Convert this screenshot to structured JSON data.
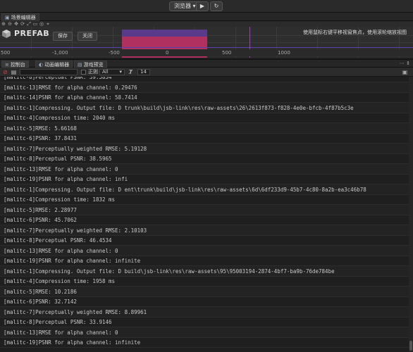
{
  "toolbar": {
    "preview_label": "浏览器 ▾",
    "play_glyph": "▶",
    "refresh_glyph": "↻"
  },
  "scene_panel": {
    "tab_label": "场景编辑器",
    "prefab_title": "PREFAB",
    "save_label": "保存",
    "close_label": "关闭",
    "hint_text": "使用鼠标右键平移视窗焦点，使用滚轮缩放视图",
    "ruler_labels": [
      "-1,000",
      "-500",
      "0",
      "500",
      "1000"
    ],
    "ruler_edge": "500"
  },
  "bottom_tabs": [
    {
      "label": "控制台"
    },
    {
      "label": "动画编辑器"
    },
    {
      "label": "游戏预览"
    }
  ],
  "console_toolbar": {
    "regex_label": "正则",
    "filter_value": "All",
    "font_size_value": "14"
  },
  "console_lines": [
    "[malitc-8]Perceptual PSNR: 39.5834",
    "[malitc-13]RMSE for alpha channel: 0.29476",
    "[malitc-14]PSNR for alpha channel: 58.7414",
    "[malitc-1]Compressing. Output file: D                        trunk\\build\\jsb-link\\res\\raw-assets\\26\\2613f873-f828-4e0e-bfcb-4f87b5c3e",
    "[malitc-4]Compression time: 2040 ms",
    "[malitc-5]RMSE: 5.66168",
    "[malitc-6]PSNR: 37.8431",
    "[malitc-7]Perceptually weighted RMSE: 5.19128",
    "[malitc-8]Perceptual PSNR: 38.5965",
    "[malitc-13]RMSE for alpha channel: 0",
    "[malitc-19]PSNR for alpha channel: infi",
    "[malitc-1]Compressing. Output file: D                      ent\\trunk\\build\\jsb-link\\res\\raw-assets\\6d\\6df233d9-45b7-4c80-8a2b-ea3c46b78",
    "[malitc-4]Compression time: 1832 ms",
    "[malitc-5]RMSE: 2.28977",
    "[malitc-6]PSNR: 45.7062",
    "[malitc-7]Perceptually weighted RMSE: 2.10103",
    "[malitc-8]Perceptual PSNR: 46.4534",
    "[malitc-13]RMSE for alpha channel: 0",
    "[malitc-19]PSNR for alpha channel: infinite",
    "[malitc-1]Compressing. Output file: D                          build\\jsb-link\\res\\raw-assets\\95\\95003194-2874-4bf7-ba9b-76de784be",
    "[malitc-4]Compression time: 1958 ms",
    "[malitc-5]RMSE: 10.2186",
    "[malitc-6]PSNR: 32.7142",
    "[malitc-7]Perceptually weighted RMSE: 8.89961",
    "[malitc-8]Perceptual PSNR: 33.9146",
    "[malitc-13]RMSE for alpha channel: 0",
    "[malitc-19]PSNR for alpha channel: infinite"
  ],
  "colors": {
    "canvas": "#b03060",
    "axis_x": "#5a3fb0",
    "axis_y": "#a03cc0",
    "error_icon": "#d04040"
  },
  "icons": {
    "prefab": "cube-icon",
    "clear": "clear-icon",
    "error": "error-icon",
    "font": "font-size-icon"
  }
}
